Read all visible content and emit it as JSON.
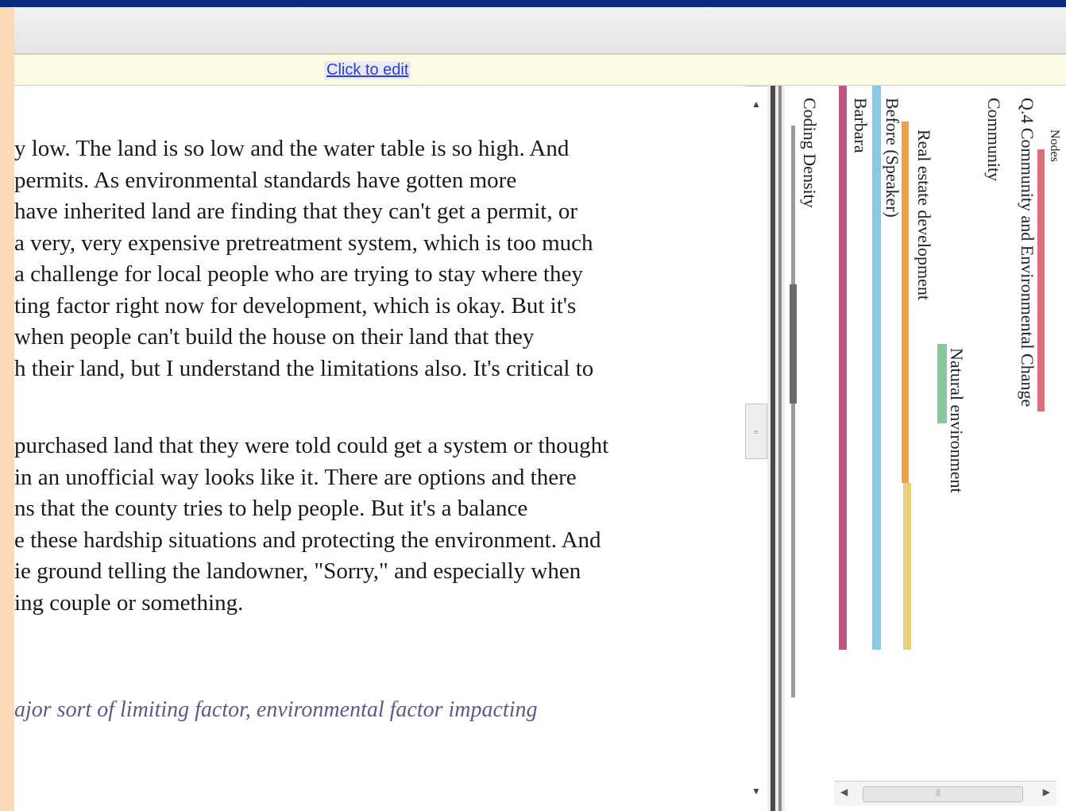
{
  "edit_bar": {
    "click_to_edit": "Click to edit"
  },
  "document": {
    "paragraph1": [
      "y low. The land is so low and the water table is so high. And",
      "permits. As environmental standards have gotten more",
      "have inherited land are finding that they can't get a permit, or",
      "a very, very expensive pretreatment system, which is too much",
      "a challenge for local people who are trying to stay where they",
      "ting factor right now for development, which is okay. But it's",
      "when people can't build the house on their land that they",
      "h their land, but I understand the limitations also. It's critical to"
    ],
    "paragraph2": [
      "purchased land that they were told could get a system or thought",
      "in an unofficial way looks like it. There are options and there",
      "ns that the county tries to help people. But it's a balance",
      "e these hardship situations and protecting the environment. And",
      "ie ground telling the landowner, \"Sorry,\" and especially when",
      "ing couple or something."
    ],
    "question": "ajor sort of limiting factor, environmental factor impacting"
  },
  "coding_stripes": [
    {
      "label": "Nodes",
      "color": "#d9707a"
    },
    {
      "label": "Q.4 Community and Environmental Change",
      "color": "#d9707a"
    },
    {
      "label": "Community",
      "color": "#ffffff"
    },
    {
      "label": "Natural environment",
      "color": "#8cc6a0"
    },
    {
      "label": "Real estate development",
      "color": "#f0a040"
    },
    {
      "label": "Before (Speaker)",
      "color": "#e8d080"
    },
    {
      "label": "Barbara",
      "color": "#8ec8e0"
    },
    {
      "label": "Coding Density",
      "color": "#c0558a"
    }
  ]
}
